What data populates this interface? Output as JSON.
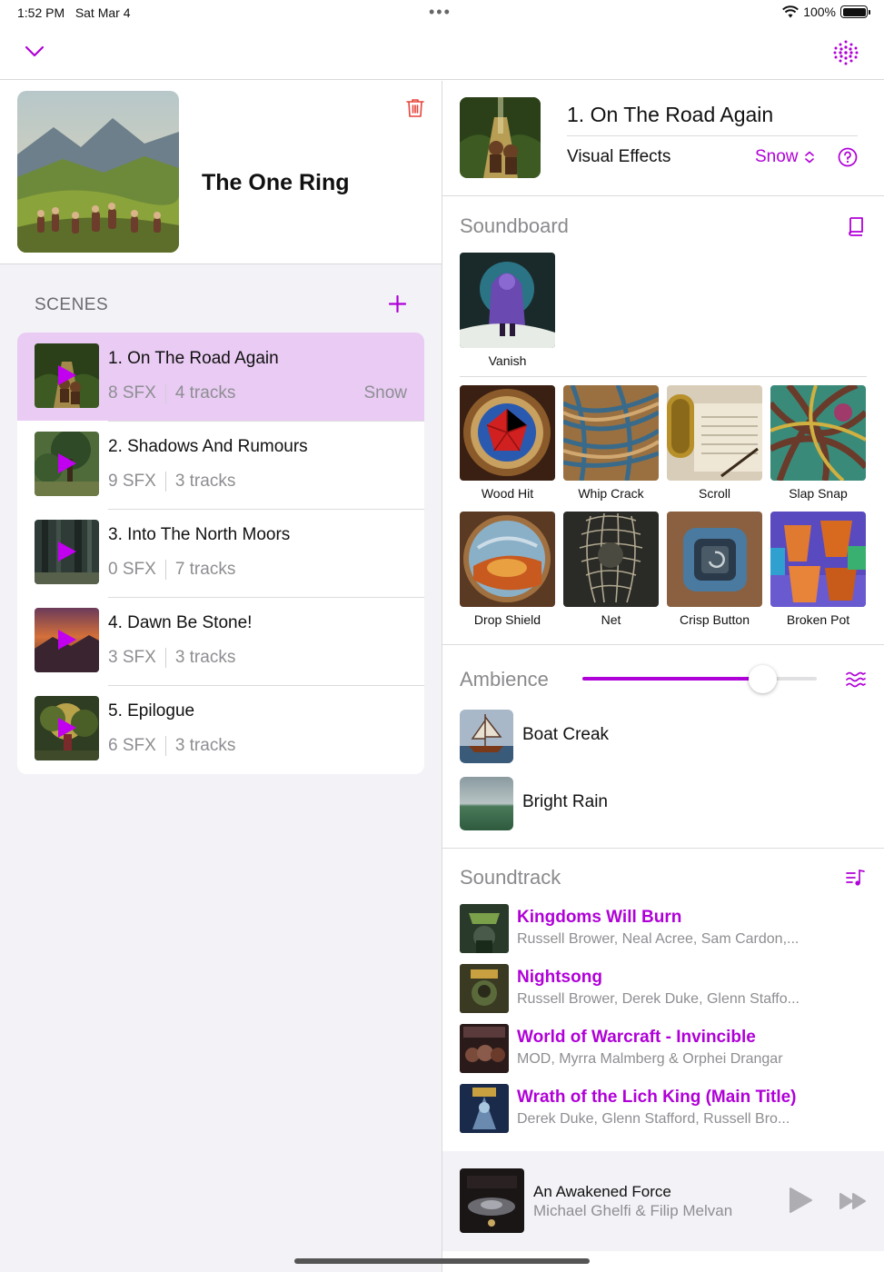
{
  "status_bar": {
    "time": "1:52 PM",
    "date": "Sat Mar 4",
    "battery": "100%"
  },
  "icons": {
    "collapse": "chevron-down-icon",
    "menu": "dots-grid-icon",
    "delete": "trash-icon",
    "add_scene": "plus-icon",
    "help": "question-circle-icon",
    "book": "book-icon",
    "ambience": "waves-icon",
    "soundtrack": "music-list-icon",
    "play": "play-icon",
    "forward": "fast-forward-icon"
  },
  "campaign": {
    "title": "The One Ring"
  },
  "scenes": {
    "header": "SCENES",
    "items": [
      {
        "name": "1. On The Road Again",
        "sfx": "8 SFX",
        "tracks": "4 tracks",
        "effect": "Snow"
      },
      {
        "name": "2. Shadows And Rumours",
        "sfx": "9 SFX",
        "tracks": "3 tracks",
        "effect": ""
      },
      {
        "name": "3. Into The North Moors",
        "sfx": "0 SFX",
        "tracks": "7 tracks",
        "effect": ""
      },
      {
        "name": "4. Dawn Be Stone!",
        "sfx": "3 SFX",
        "tracks": "3 tracks",
        "effect": ""
      },
      {
        "name": "5. Epilogue",
        "sfx": "6 SFX",
        "tracks": "3 tracks",
        "effect": ""
      }
    ]
  },
  "scene_detail": {
    "title": "1. On The Road Again",
    "visual_effects_label": "Visual Effects",
    "visual_effects_value": "Snow"
  },
  "soundboard": {
    "title": "Soundboard",
    "featured": [
      {
        "label": "Vanish"
      }
    ],
    "items": [
      {
        "label": "Wood Hit"
      },
      {
        "label": "Whip Crack"
      },
      {
        "label": "Scroll"
      },
      {
        "label": "Slap Snap"
      },
      {
        "label": "Drop Shield"
      },
      {
        "label": "Net"
      },
      {
        "label": "Crisp Button"
      },
      {
        "label": "Broken Pot"
      }
    ]
  },
  "ambience": {
    "title": "Ambience",
    "volume": 0.77,
    "items": [
      {
        "label": "Boat Creak"
      },
      {
        "label": "Bright Rain"
      }
    ]
  },
  "soundtrack": {
    "title": "Soundtrack",
    "tracks": [
      {
        "title": "Kingdoms Will Burn",
        "artist": "Russell Brower, Neal Acree, Sam Cardon,..."
      },
      {
        "title": "Nightsong",
        "artist": "Russell Brower, Derek Duke, Glenn Staffo..."
      },
      {
        "title": "World of Warcraft - Invincible",
        "artist": "MOD, Myrra Malmberg & Orphei Drangar"
      },
      {
        "title": "Wrath of the Lich King (Main Title)",
        "artist": "Derek Duke, Glenn Stafford, Russell Bro..."
      }
    ]
  },
  "now_playing": {
    "title": "An Awakened Force",
    "artist": "Michael Ghelfi & Filip Melvan"
  },
  "colors": {
    "accent": "#b000d8",
    "active_row": "#e9cbf3",
    "delete": "#e5443a"
  }
}
